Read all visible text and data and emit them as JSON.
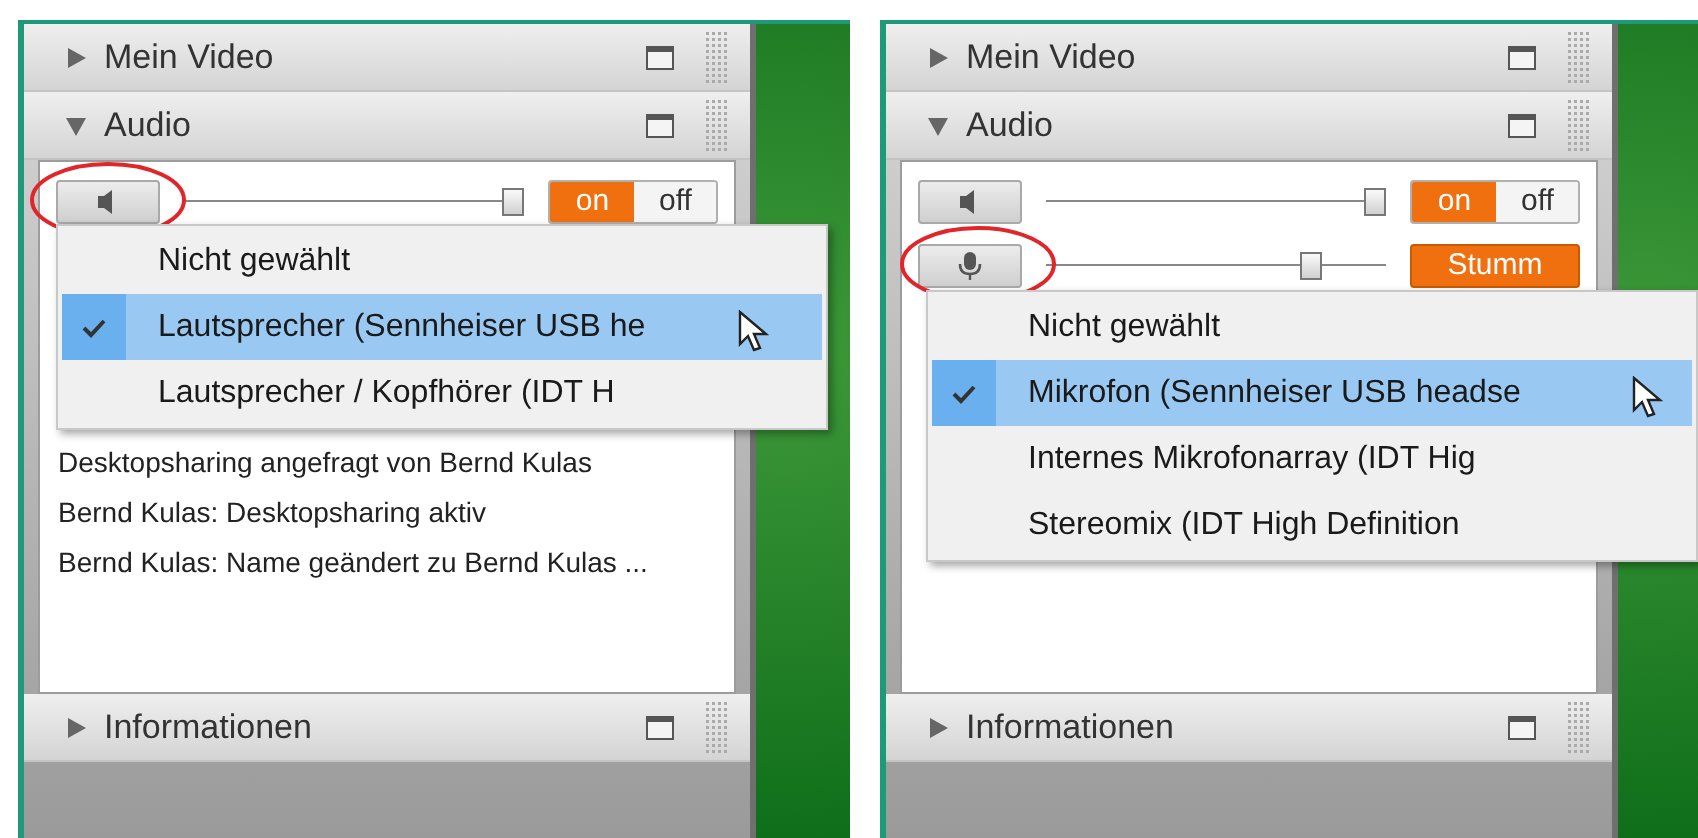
{
  "screens": [
    {
      "sections": [
        {
          "title": "Mein Video",
          "expanded": false
        },
        {
          "title": "Audio",
          "expanded": true
        }
      ],
      "audio_rows": [
        {
          "kind": "speaker",
          "annotated": true,
          "level": 1,
          "control": {
            "kind": "toggle",
            "on_label": "on",
            "off_label": "off",
            "on": true
          }
        }
      ],
      "dropdown": {
        "items": [
          {
            "label": "Nicht gewählt",
            "selected": false
          },
          {
            "label": "Lautsprecher (Sennheiser USB he",
            "selected": true
          },
          {
            "label": "Lautsprecher / Kopfhörer (IDT H",
            "selected": false
          }
        ]
      },
      "log": [
        "Desktopsharing angefragt von Bernd Kulas",
        "Bernd Kulas: Desktopsharing aktiv",
        "Bernd Kulas: Name geändert zu Bernd Kulas ..."
      ],
      "footer_section": {
        "title": "Informationen",
        "expanded": false
      }
    },
    {
      "sections": [
        {
          "title": "Mein Video",
          "expanded": false
        },
        {
          "title": "Audio",
          "expanded": true
        }
      ],
      "audio_rows": [
        {
          "kind": "speaker",
          "annotated": false,
          "level": 1,
          "control": {
            "kind": "toggle",
            "on_label": "on",
            "off_label": "off",
            "on": true
          }
        },
        {
          "kind": "microphone",
          "annotated": true,
          "level": 0.8,
          "control": {
            "kind": "button",
            "label": "Stumm"
          }
        }
      ],
      "dropdown": {
        "items": [
          {
            "label": "Nicht gewählt",
            "selected": false
          },
          {
            "label": "Mikrofon (Sennheiser USB headse",
            "selected": true
          },
          {
            "label": "Internes Mikrofonarray (IDT Hig",
            "selected": false
          },
          {
            "label": "Stereomix (IDT High Definition",
            "selected": false
          }
        ]
      },
      "footer_section": {
        "title": "Informationen",
        "expanded": false
      }
    }
  ]
}
